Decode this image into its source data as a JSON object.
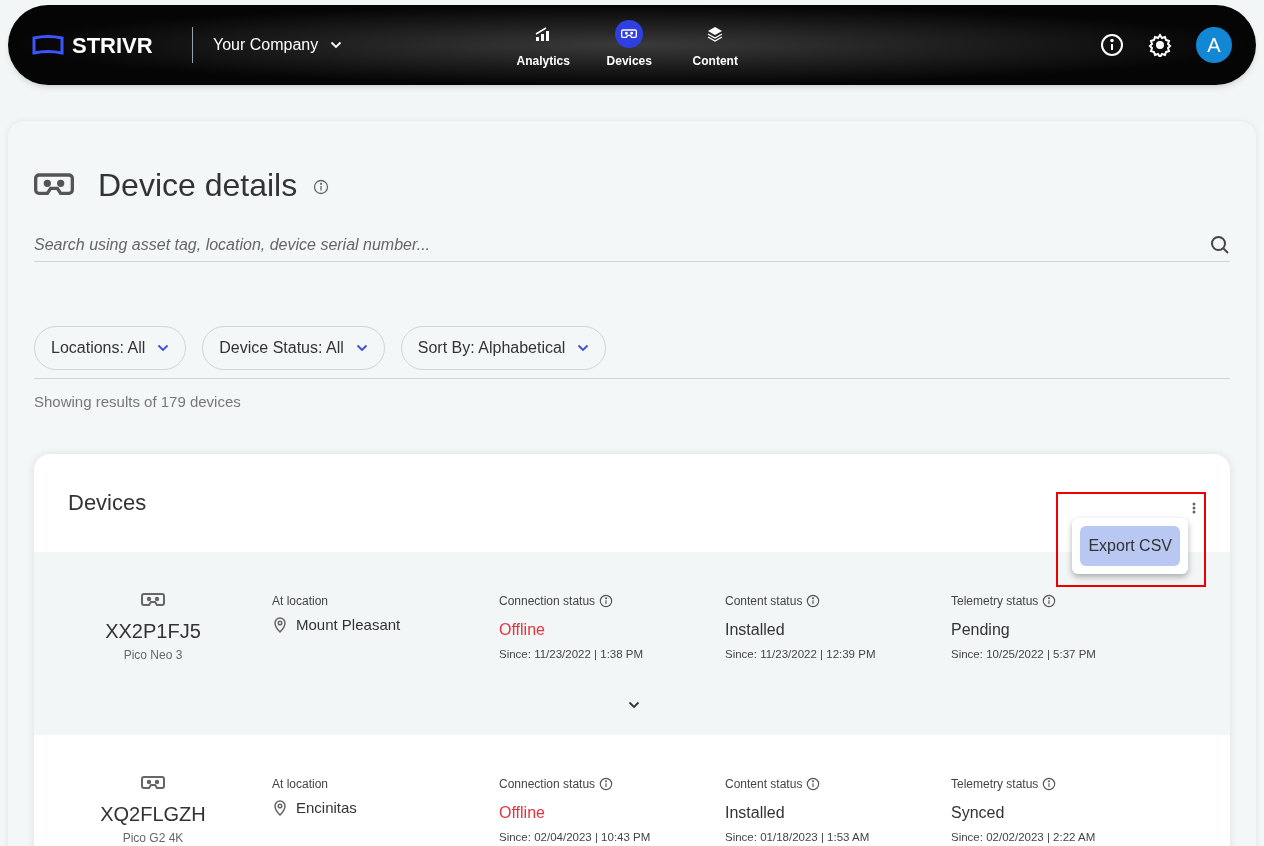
{
  "header": {
    "brand": "STRIVR",
    "company": "Your Company",
    "nav": [
      {
        "label": "Analytics",
        "selected": false
      },
      {
        "label": "Devices",
        "selected": true
      },
      {
        "label": "Content",
        "selected": false
      }
    ],
    "avatar": "A"
  },
  "page": {
    "title": "Device details",
    "search": {
      "placeholder": "Search using asset tag, location, device serial number..."
    },
    "filters": [
      "Locations: All",
      "Device Status: All",
      "Sort By: Alphabetical"
    ],
    "results": "Showing results of 179 devices"
  },
  "devices": {
    "title": "Devices",
    "menu": {
      "open": true,
      "items": [
        "Export CSV"
      ]
    },
    "rows": [
      {
        "highlighted": true,
        "serial": "XX2P1FJ5",
        "model": "Pico Neo 3",
        "location_label": "At location",
        "location": "Mount Pleasant",
        "statuses": [
          {
            "label": "Connection status",
            "value": "Offline",
            "alert": true,
            "since": "Since: 11/23/2022 | 1:38 PM"
          },
          {
            "label": "Content status",
            "value": "Installed",
            "alert": false,
            "since": "Since: 11/23/2022 | 12:39 PM"
          },
          {
            "label": "Telemetry status",
            "value": "Pending",
            "alert": false,
            "since": "Since: 10/25/2022 | 5:37 PM"
          }
        ]
      },
      {
        "highlighted": false,
        "serial": "XQ2FLGZH",
        "model": "Pico G2 4K",
        "location_label": "At location",
        "location": "Encinitas",
        "statuses": [
          {
            "label": "Connection status",
            "value": "Offline",
            "alert": true,
            "since": "Since: 02/04/2023 | 10:43 PM"
          },
          {
            "label": "Content status",
            "value": "Installed",
            "alert": false,
            "since": "Since: 01/18/2023 | 1:53 AM"
          },
          {
            "label": "Telemetry status",
            "value": "Synced",
            "alert": false,
            "since": "Since: 02/02/2023 | 2:22 AM"
          }
        ]
      }
    ]
  }
}
